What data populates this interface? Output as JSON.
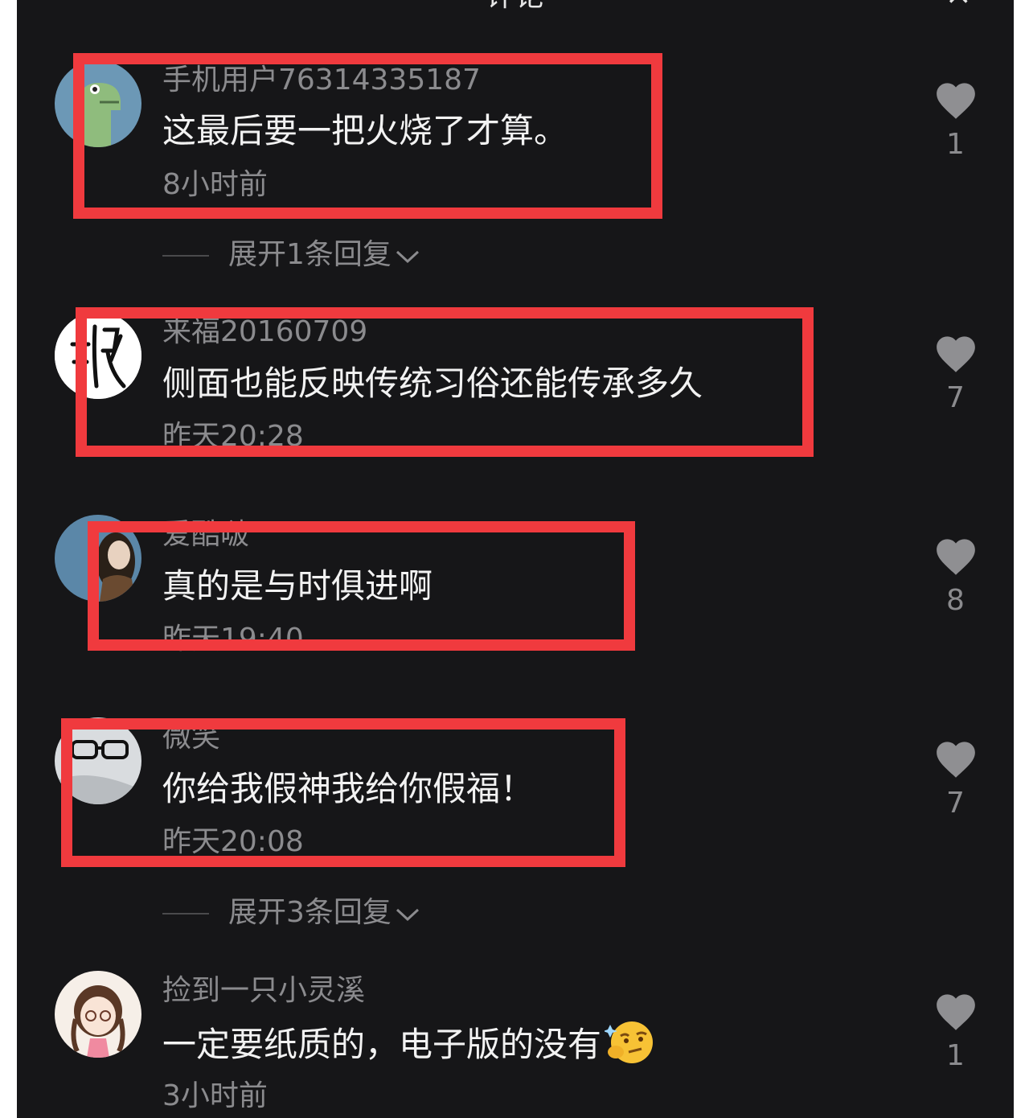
{
  "header": {
    "title": "评论",
    "close": "×"
  },
  "comments": [
    {
      "username": "手机用户76314335187",
      "text": "这最后要一把火烧了才算。",
      "time": "8小时前",
      "likes": "1",
      "expand": "展开1条回复"
    },
    {
      "username": "来福20160709",
      "text": "侧面也能反映传统习俗还能传承多久",
      "time": "昨天20:28",
      "likes": "7"
    },
    {
      "username": "爱酷啵",
      "text": "真的是与时俱进啊",
      "time": "昨天19:40",
      "likes": "8"
    },
    {
      "username": "微笑",
      "text": "你给我假神我给你假福！",
      "time": "昨天20:08",
      "likes": "7",
      "expand": "展开3条回复"
    },
    {
      "username": "捡到一只小灵溪",
      "text": "一定要纸质的，电子版的没有",
      "time": "3小时前",
      "likes": "1"
    }
  ],
  "colors": {
    "background": "#161618",
    "highlight": "#f03a3e",
    "text_primary": "#f2f2f2",
    "text_secondary": "#8b8b8e"
  }
}
